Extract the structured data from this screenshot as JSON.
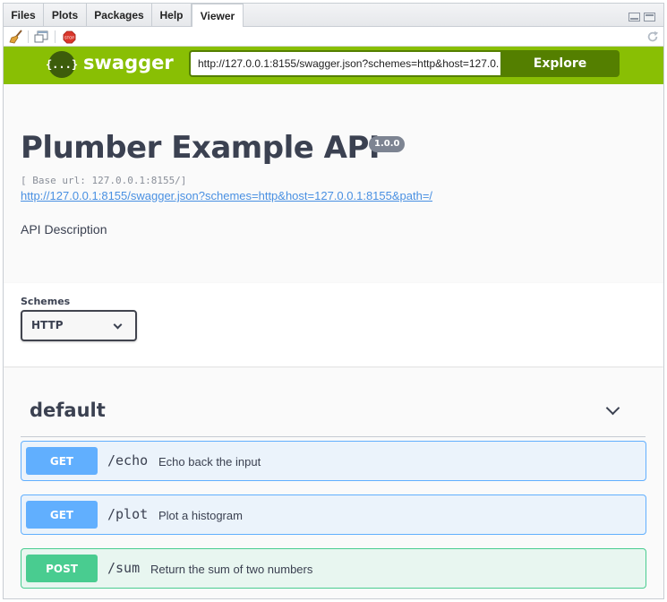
{
  "tabs": [
    "Files",
    "Plots",
    "Packages",
    "Help",
    "Viewer"
  ],
  "active_tab": "Viewer",
  "topbar": {
    "logo_symbol": "{...}",
    "logo_text": "swagger",
    "url_value": "http://127.0.0.1:8155/swagger.json?schemes=http&host=127.0.",
    "explore_label": "Explore",
    "color": "#89bf04"
  },
  "info": {
    "title": "Plumber Example API",
    "version": "1.0.0",
    "base_url": "[ Base url: 127.0.0.1:8155/]",
    "spec_link": "http://127.0.0.1:8155/swagger.json?schemes=http&host=127.0.0.1:8155&path=/",
    "description": "API Description"
  },
  "schemes": {
    "label": "Schemes",
    "selected": "HTTP"
  },
  "tag": {
    "name": "default"
  },
  "operations": [
    {
      "method": "GET",
      "path": "/echo",
      "summary": "Echo back the input"
    },
    {
      "method": "GET",
      "path": "/plot",
      "summary": "Plot a histogram"
    },
    {
      "method": "POST",
      "path": "/sum",
      "summary": "Return the sum of two numbers"
    }
  ],
  "colors": {
    "get": "#61affe",
    "post": "#49cc90",
    "text": "#3b4151"
  }
}
